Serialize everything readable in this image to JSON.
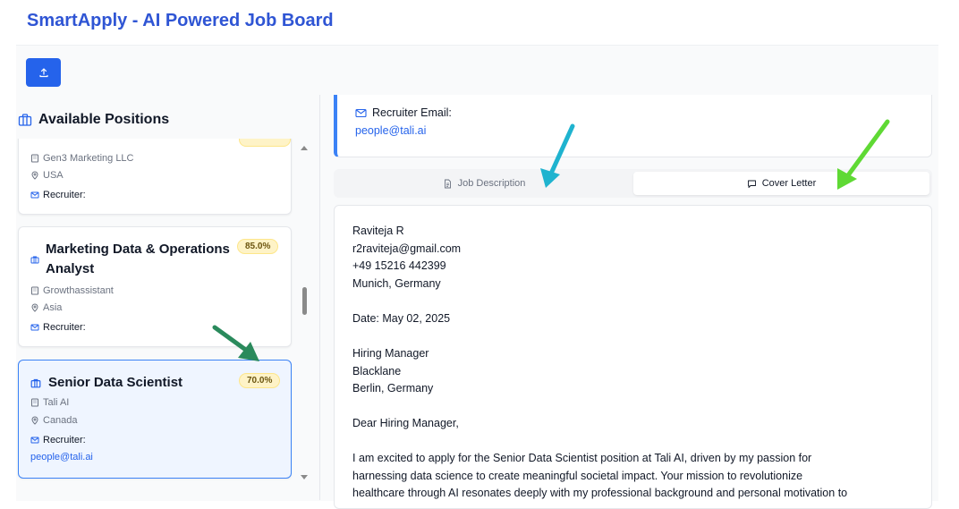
{
  "app": {
    "title": "SmartApply - AI Powered Job Board"
  },
  "toolbar": {
    "upload_icon": "upload-icon"
  },
  "sidebar": {
    "title": "Available Positions",
    "jobs": [
      {
        "title": "",
        "company": "Gen3 Marketing LLC",
        "location": "USA",
        "recruiter_label": "Recruiter:",
        "recruiter_email": ""
      },
      {
        "title_line1": "Marketing Data & Operations",
        "title_line2": "Analyst",
        "score": "85.0%",
        "company": "Growthassistant",
        "location": "Asia",
        "recruiter_label": "Recruiter:",
        "recruiter_email": ""
      },
      {
        "title": "Senior Data Scientist",
        "score": "70.0%",
        "company": "Tali AI",
        "location": "Canada",
        "recruiter_label": "Recruiter:",
        "recruiter_email": "people@tali.ai",
        "selected": true
      }
    ]
  },
  "detail": {
    "recruiter_email_label": "Recruiter Email:",
    "recruiter_email": "people@tali.ai",
    "tabs": [
      {
        "label": "Job Description",
        "active": false
      },
      {
        "label": "Cover Letter",
        "active": true
      }
    ],
    "cover_letter": {
      "lines": [
        "Raviteja R",
        "r2raviteja@gmail.com",
        "+49 15216 442399",
        "Munich, Germany",
        "Date: May 02, 2025",
        "Hiring Manager",
        "Blacklane",
        "Berlin, Germany",
        "Dear Hiring Manager,",
        "I am excited to apply for the Senior Data Scientist position at Tali AI, driven by my passion for",
        "harnessing data science to create meaningful societal impact. Your mission to revolutionize",
        "healthcare through AI resonates deeply with my professional background and personal motivation to"
      ]
    }
  },
  "colors": {
    "brand": "#2f55d4",
    "primary": "#2563eb",
    "selected_border": "#3b82f6",
    "badge_bg": "#fef3c7",
    "annotation_teal": "#1fb3cf",
    "annotation_green": "#5fd934",
    "annotation_darkgreen": "#2a8a5c"
  }
}
